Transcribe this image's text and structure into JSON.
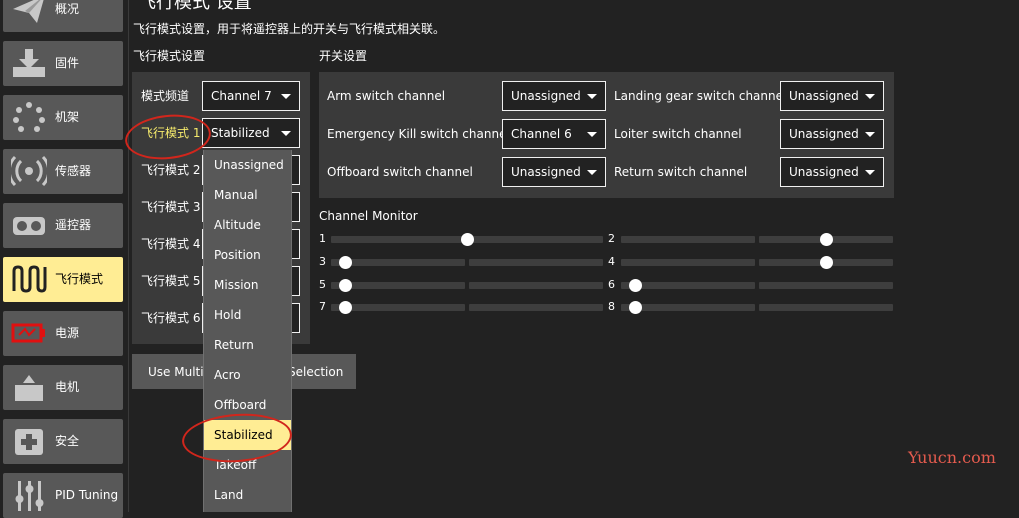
{
  "sidebar": {
    "items": [
      {
        "label": "概况",
        "icon": "paper-plane-icon"
      },
      {
        "label": "固件",
        "icon": "firmware-download-icon"
      },
      {
        "label": "机架",
        "icon": "airframe-icon"
      },
      {
        "label": "传感器",
        "icon": "sensor-signal-icon"
      },
      {
        "label": "遥控器",
        "icon": "radio-controller-icon"
      },
      {
        "label": "飞行模式",
        "icon": "flight-modes-wave-icon"
      },
      {
        "label": "电源",
        "icon": "battery-icon"
      },
      {
        "label": "电机",
        "icon": "motor-icon"
      },
      {
        "label": "安全",
        "icon": "safety-plus-icon"
      },
      {
        "label": "PID Tuning",
        "icon": "pid-sliders-icon"
      }
    ],
    "active_index": 5
  },
  "page": {
    "title": "飞行模式 设置",
    "description": "飞行模式设置，用于将遥控器上的开关与飞行模式相关联。"
  },
  "flight_mode_settings": {
    "section_label": "飞行模式设置",
    "mode_channel_label": "模式频道",
    "mode_channel_value": "Channel 7",
    "modes": [
      {
        "label": "飞行模式 1",
        "value": "Stabilized"
      },
      {
        "label": "飞行模式 2",
        "value": ""
      },
      {
        "label": "飞行模式 3",
        "value": ""
      },
      {
        "label": "飞行模式 4",
        "value": ""
      },
      {
        "label": "飞行模式 5",
        "value": ""
      },
      {
        "label": "飞行模式 6",
        "value": ""
      }
    ],
    "multi_channel_button": "Use Multi Channel Mode Selection",
    "multi_channel_button_left": "Use Multi",
    "multi_channel_button_right": "Selection"
  },
  "dropdown": {
    "options": [
      "Unassigned",
      "Manual",
      "Altitude",
      "Position",
      "Mission",
      "Hold",
      "Return",
      "Acro",
      "Offboard",
      "Stabilized",
      "Takeoff",
      "Land"
    ],
    "selected": "Stabilized"
  },
  "switch_settings": {
    "section_label": "开关设置",
    "switches": [
      {
        "label": "Arm switch channel",
        "value": "Unassigned"
      },
      {
        "label": "Landing gear switch channel",
        "value": "Unassigned"
      },
      {
        "label": "Emergency Kill switch channel",
        "value": "Channel 6"
      },
      {
        "label": "Loiter switch channel",
        "value": "Unassigned"
      },
      {
        "label": "Offboard switch channel",
        "value": "Unassigned"
      },
      {
        "label": "Return switch channel",
        "value": "Unassigned"
      }
    ]
  },
  "channel_monitor": {
    "title": "Channel Monitor",
    "channels": [
      {
        "num": "1",
        "value": 0.5
      },
      {
        "num": "2",
        "value": 0.75
      },
      {
        "num": "3",
        "value": 0.05
      },
      {
        "num": "4",
        "value": 0.75
      },
      {
        "num": "5",
        "value": 0.05
      },
      {
        "num": "6",
        "value": 0.05
      },
      {
        "num": "7",
        "value": 0.05
      },
      {
        "num": "8",
        "value": 0.05
      }
    ]
  },
  "watermark": "Yuucn.com",
  "colors": {
    "accent": "#ffed94",
    "panel": "#3a3a3a",
    "button": "#585858",
    "annotation": "#d1261c",
    "watermark": "#e45b4e"
  }
}
